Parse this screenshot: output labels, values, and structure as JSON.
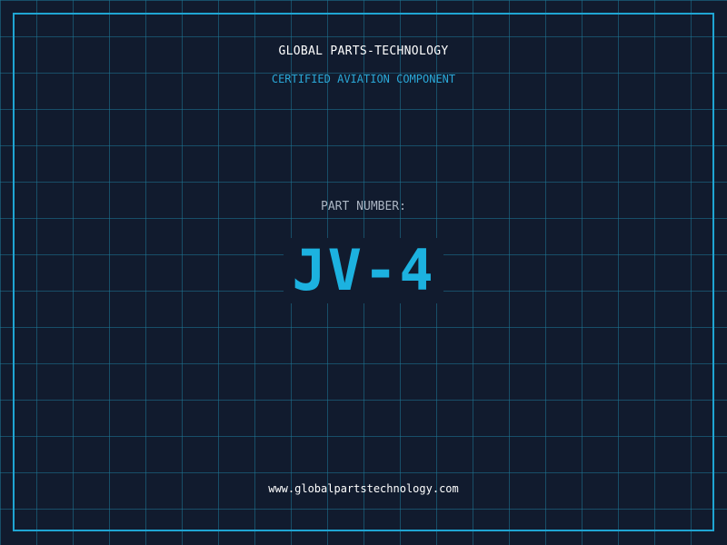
{
  "header": {
    "company": "GLOBAL PARTS-TECHNOLOGY",
    "tagline": "CERTIFIED AVIATION COMPONENT"
  },
  "part": {
    "label": "PART NUMBER:",
    "number": "JV-4"
  },
  "footer": {
    "website": "www.globalpartstechnology.com"
  },
  "colors": {
    "background": "#111b2e",
    "grid": "#1e7896",
    "border": "#1fa5d3",
    "accent": "#1cb2e0",
    "text": "#ffffff",
    "muted": "#aab4c2"
  }
}
